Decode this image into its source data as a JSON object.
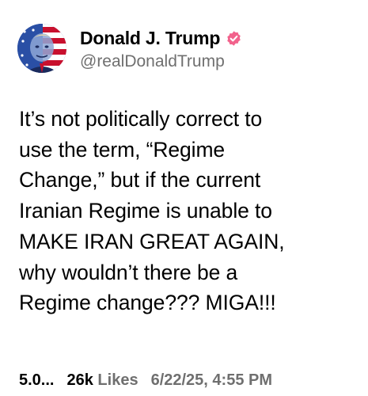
{
  "post": {
    "author": {
      "display_name": "Donald J. Trump",
      "handle": "@realDonaldTrump",
      "verified_icon": "verified-badge-icon",
      "verified_color": "#f2628c",
      "avatar_icon": "profile-avatar-flag-portrait"
    },
    "text": "It’s not politically correct to\nuse the term, “Regime\nChange,” but if the current\nIranian Regime is unable to\nMAKE IRAN GREAT AGAIN,\nwhy wouldn’t there be a\nRegime change??? MIGA!!!",
    "stats": {
      "views": "5.0...",
      "likes_count": "26k",
      "likes_label": "Likes",
      "timestamp": "6/22/25, 4:55 PM"
    }
  },
  "colors": {
    "text": "#000000",
    "secondary_text": "#6f6f6f",
    "background": "#ffffff"
  }
}
